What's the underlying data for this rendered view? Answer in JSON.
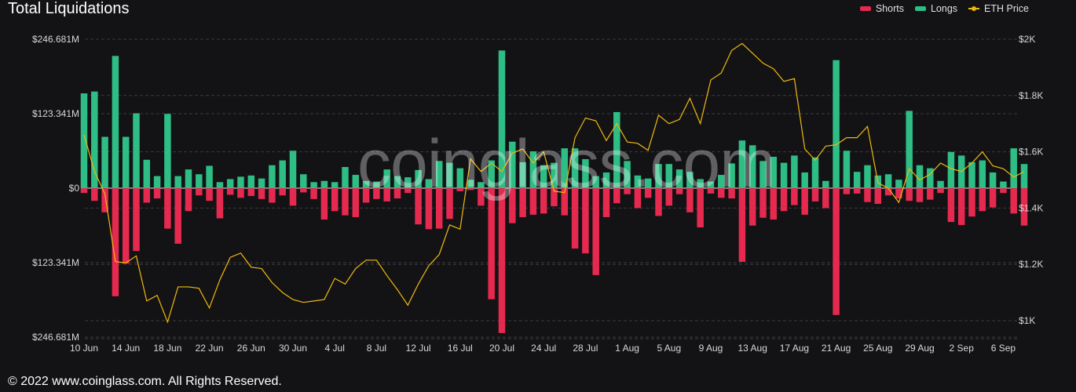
{
  "header": {
    "title": "Total Liquidations"
  },
  "legend": [
    {
      "label": "Shorts",
      "color": "#e5294f"
    },
    {
      "label": "Longs",
      "color": "#2ebd85"
    },
    {
      "label": "ETH Price",
      "color": "#f0b90b"
    }
  ],
  "watermark": "coinglass.com",
  "footer": "© 2022 www.coinglass.com. All Rights Reserved.",
  "chart_data": {
    "type": "bar",
    "title": "Total Liquidations",
    "left_axis": {
      "ticks": [
        "$246.681M",
        "$123.341M",
        "$0",
        "$123.341M",
        "$246.681M"
      ],
      "range_musd": [
        -246.681,
        246.681
      ]
    },
    "right_axis": {
      "ticks": [
        "$2K",
        "$1.8K",
        "$1.6K",
        "$1.4K",
        "$1.2K",
        "$1K"
      ],
      "range_usd": [
        950,
        2000
      ]
    },
    "x_tick_labels": [
      "10 Jun",
      "14 Jun",
      "18 Jun",
      "22 Jun",
      "26 Jun",
      "30 Jun",
      "4 Jul",
      "8 Jul",
      "12 Jul",
      "16 Jul",
      "20 Jul",
      "24 Jul",
      "28 Jul",
      "1 Aug",
      "5 Aug",
      "9 Aug",
      "13 Aug",
      "17 Aug",
      "21 Aug",
      "25 Aug",
      "29 Aug",
      "2 Sep",
      "6 Sep"
    ],
    "x_start": "10 Jun",
    "grid": true,
    "legend_position": "top-right",
    "series": [
      {
        "name": "Longs",
        "unit": "M USD",
        "values": [
          157,
          160,
          85,
          219,
          85,
          124,
          47,
          20,
          123,
          20,
          31,
          23,
          37,
          10,
          15,
          19,
          21,
          16,
          38,
          46,
          62,
          23,
          10,
          12,
          10,
          35,
          22,
          12,
          11,
          31,
          20,
          18,
          30,
          15,
          45,
          42,
          33,
          14,
          10,
          46,
          228,
          77,
          43,
          61,
          38,
          42,
          66,
          66,
          48,
          20,
          26,
          126,
          45,
          21,
          16,
          40,
          40,
          31,
          27,
          15,
          11,
          22,
          41,
          79,
          71,
          45,
          52,
          42,
          54,
          26,
          51,
          12,
          212,
          62,
          27,
          38,
          21,
          23,
          14,
          128,
          38,
          33,
          12,
          60,
          54,
          43,
          46,
          26,
          11,
          66,
          40
        ],
        "note": "approximate per-day values read from chart"
      },
      {
        "name": "Shorts",
        "unit": "M USD",
        "values": [
          8,
          21,
          40,
          179,
          125,
          104,
          24,
          17,
          67,
          92,
          38,
          12,
          21,
          50,
          11,
          16,
          13,
          18,
          24,
          12,
          29,
          7,
          18,
          52,
          38,
          45,
          48,
          24,
          18,
          22,
          17,
          8,
          60,
          68,
          67,
          51,
          5,
          3,
          29,
          184,
          240,
          58,
          48,
          44,
          42,
          30,
          45,
          100,
          108,
          144,
          48,
          25,
          10,
          33,
          16,
          46,
          29,
          10,
          40,
          65,
          9,
          16,
          17,
          122,
          62,
          49,
          52,
          38,
          28,
          44,
          22,
          33,
          210,
          10,
          9,
          23,
          26,
          12,
          17,
          21,
          23,
          19,
          8,
          56,
          61,
          47,
          38,
          32,
          8,
          42,
          62
        ],
        "note": "approximate per-day values (shown below zero)"
      },
      {
        "name": "ETH Price",
        "unit": "USD",
        "values": [
          1660,
          1530,
          1450,
          1210,
          1205,
          1230,
          1070,
          1090,
          995,
          1120,
          1120,
          1115,
          1045,
          1145,
          1225,
          1240,
          1190,
          1185,
          1135,
          1100,
          1075,
          1065,
          1070,
          1075,
          1150,
          1130,
          1185,
          1215,
          1215,
          1160,
          1110,
          1055,
          1130,
          1195,
          1235,
          1340,
          1325,
          1575,
          1530,
          1560,
          1530,
          1595,
          1610,
          1560,
          1600,
          1460,
          1455,
          1650,
          1720,
          1710,
          1640,
          1700,
          1635,
          1630,
          1605,
          1730,
          1700,
          1715,
          1790,
          1700,
          1855,
          1880,
          1960,
          1985,
          1950,
          1915,
          1895,
          1850,
          1860,
          1610,
          1570,
          1620,
          1625,
          1650,
          1650,
          1690,
          1490,
          1470,
          1420,
          1540,
          1500,
          1520,
          1560,
          1540,
          1530,
          1560,
          1600,
          1550,
          1540,
          1510,
          1530
        ]
      }
    ]
  }
}
